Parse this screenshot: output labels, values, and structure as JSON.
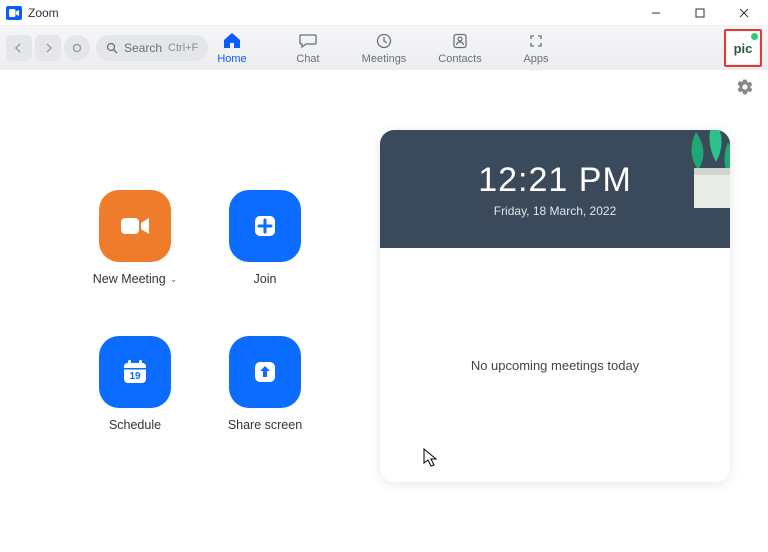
{
  "window": {
    "title": "Zoom"
  },
  "toolbar": {
    "search_label": "Search",
    "search_shortcut": "Ctrl+F"
  },
  "nav": {
    "home": "Home",
    "chat": "Chat",
    "meetings": "Meetings",
    "contacts": "Contacts",
    "apps": "Apps"
  },
  "avatar": {
    "text": "pic"
  },
  "actions": {
    "new_meeting": "New Meeting",
    "join": "Join",
    "schedule": "Schedule",
    "share_screen": "Share screen",
    "schedule_day": "19"
  },
  "card": {
    "time": "12:21 PM",
    "date": "Friday, 18 March, 2022",
    "empty": "No upcoming meetings today"
  }
}
